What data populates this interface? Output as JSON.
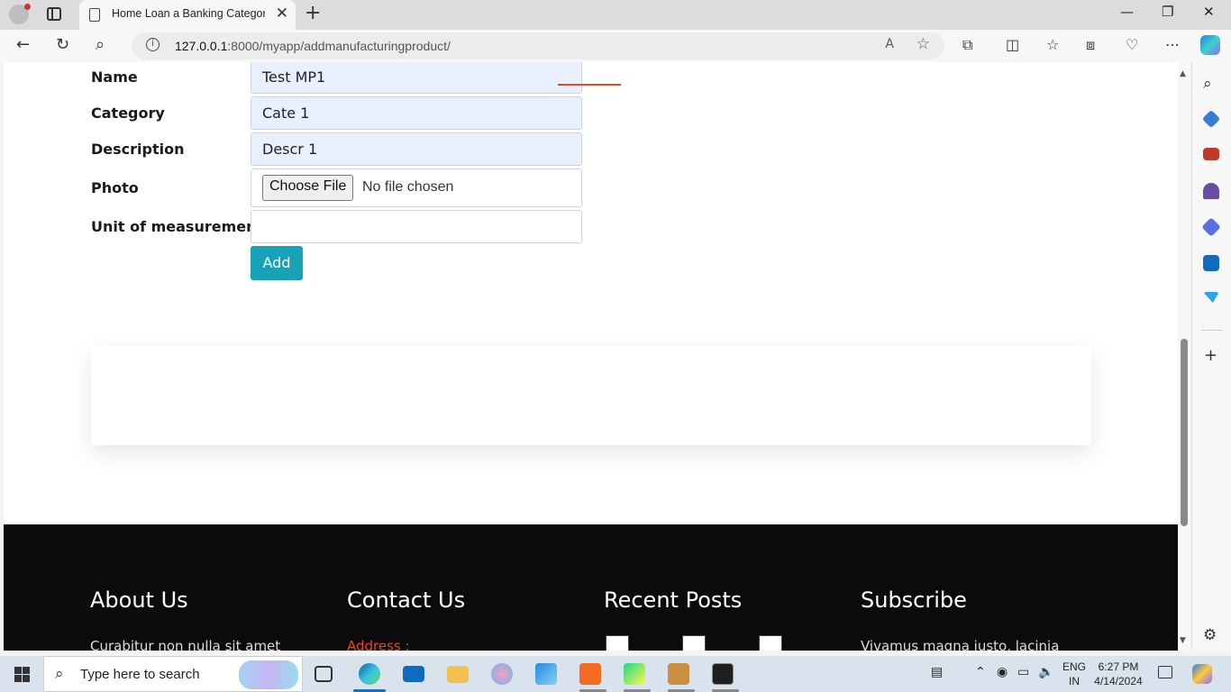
{
  "browser": {
    "tab_title": "Home Loan a Banking Category I",
    "tab_close": "✕",
    "new_tab": "+",
    "url_host": "127.0.0.1",
    "url_rest": ":8000/myapp/addmanufacturingproduct/",
    "info_glyph": "i",
    "read_aloud": "A",
    "favorite": "☆",
    "minimize": "—",
    "restore": "❐",
    "close": "✕",
    "back": "←",
    "reload": "↻",
    "search": "⌕"
  },
  "form": {
    "fields": [
      {
        "label": "Name",
        "value": "Test MP1"
      },
      {
        "label": "Category",
        "value": "Cate 1"
      },
      {
        "label": "Description",
        "value": "Descr 1"
      },
      {
        "label": "Photo",
        "button": "Choose File",
        "status": "No file chosen"
      },
      {
        "label": "Unit of measurement",
        "value": ""
      }
    ],
    "submit_label": "Add"
  },
  "footer": {
    "columns": [
      {
        "heading": "About Us",
        "text": "Curabitur non nulla sit amet"
      },
      {
        "heading": "Contact Us",
        "text": "Address :"
      },
      {
        "heading": "Recent Posts"
      },
      {
        "heading": "Subscribe",
        "text": "Vivamus magna justo, lacinia"
      }
    ]
  },
  "taskbar": {
    "search_placeholder": "Type here to search",
    "lang_line1": "ENG",
    "lang_line2": "IN",
    "time": "6:27 PM",
    "date": "4/14/2024"
  },
  "colors": {
    "accent_button": "#17a2b8",
    "footer_bg": "#0b0b0d",
    "footer_accent": "#e8491d",
    "autofill_bg": "#e8f0fe"
  },
  "icons": {
    "sidebar": [
      "search-icon",
      "tag-icon",
      "toolbox-icon",
      "chess-icon",
      "m365-icon",
      "outlook-icon",
      "send-icon"
    ],
    "taskbar_apps": [
      "task-view-icon",
      "edge-icon",
      "mail-icon",
      "file-explorer-icon",
      "paint-icon",
      "photos-icon",
      "xampp-icon",
      "pycharm-icon",
      "box-icon",
      "terminal-icon"
    ]
  }
}
